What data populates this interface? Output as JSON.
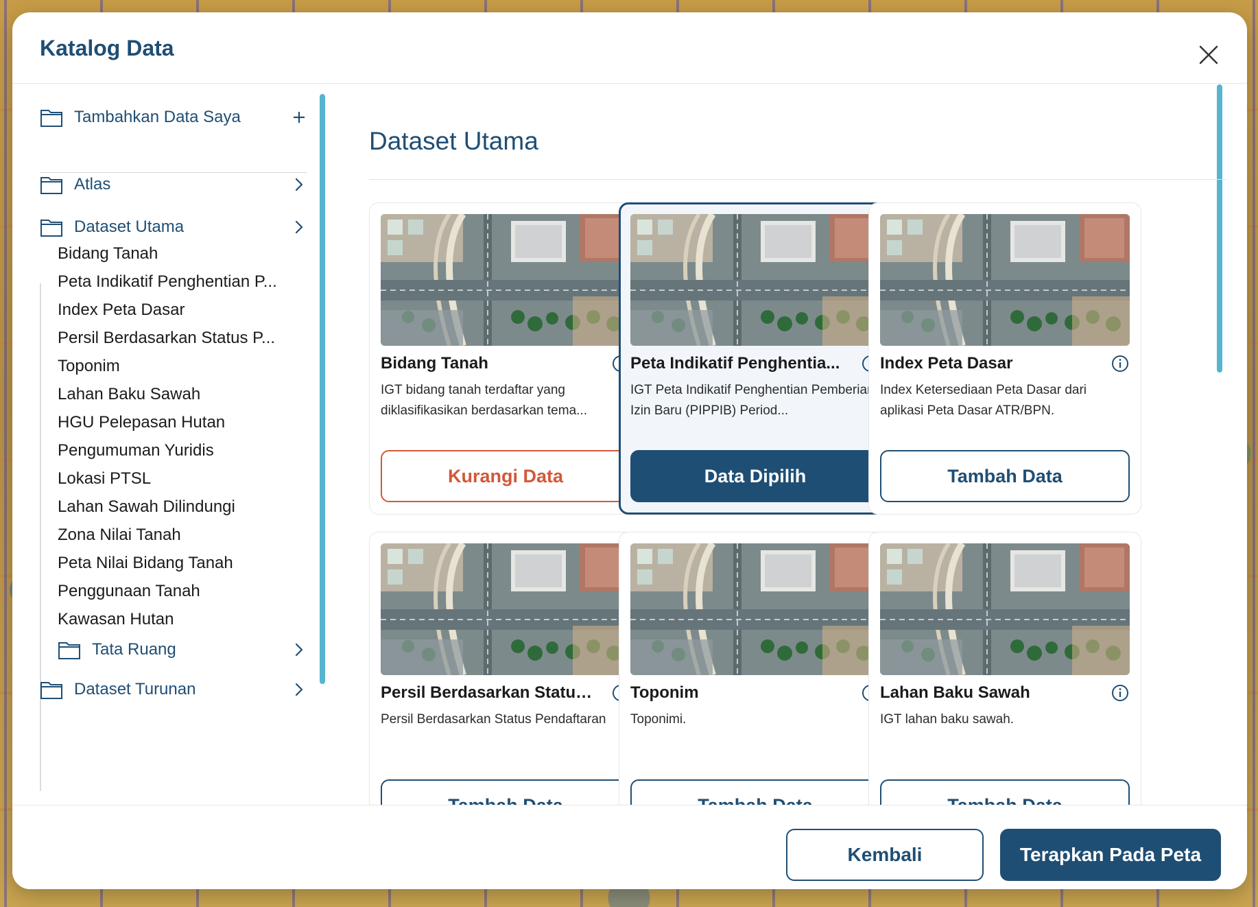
{
  "dialog": {
    "title": "Katalog Data",
    "close_icon": "close-icon"
  },
  "sidebar": {
    "add_item": {
      "label": "Tambahkan Data Saya",
      "icon": "folder-icon",
      "trail_icon": "plus-icon"
    },
    "folders": [
      {
        "label": "Atlas",
        "icon": "folder-icon",
        "trail_icon": "chevron-right-icon"
      },
      {
        "label": "Dataset Utama",
        "icon": "folder-icon",
        "trail_icon": "chevron-right-icon"
      }
    ],
    "sub_items": [
      "Bidang Tanah",
      "Peta Indikatif Penghentian P...",
      "Index Peta Dasar",
      "Persil Berdasarkan Status P...",
      "Toponim",
      "Lahan Baku Sawah",
      "HGU Pelepasan Hutan",
      "Pengumuman Yuridis",
      "Lokasi PTSL",
      "Lahan Sawah Dilindungi",
      "Zona Nilai Tanah",
      "Peta Nilai Bidang Tanah",
      "Penggunaan Tanah",
      "Kawasan Hutan"
    ],
    "nested_folder": {
      "label": "Tata Ruang",
      "icon": "folder-icon",
      "trail_icon": "chevron-right-icon"
    },
    "cut_folder": {
      "label": "Dataset Turunan",
      "icon": "folder-icon",
      "trail_icon": "chevron-right-icon"
    }
  },
  "main": {
    "title": "Dataset Utama",
    "cards": [
      {
        "title": "Bidang Tanah",
        "desc": "IGT bidang tanah terdaftar yang diklasifikasikan berdasarkan tema...",
        "button": "Kurangi Data",
        "state": "remove"
      },
      {
        "title": "Peta Indikatif Penghentia...",
        "desc": "IGT Peta Indikatif Penghentian Pemberian Izin Baru (PIPPIB) Period...",
        "button": "Data Dipilih",
        "state": "chosen"
      },
      {
        "title": "Index Peta Dasar",
        "desc": "Index Ketersediaan Peta Dasar dari aplikasi Peta Dasar ATR/BPN.",
        "button": "Tambah Data",
        "state": "add"
      },
      {
        "title": "Persil Berdasarkan Status ...",
        "desc": "Persil Berdasarkan Status Pendaftaran",
        "button": "Tambah Data",
        "state": "add"
      },
      {
        "title": "Toponim",
        "desc": "Toponimi.",
        "button": "Tambah Data",
        "state": "add"
      },
      {
        "title": "Lahan Baku Sawah",
        "desc": "IGT lahan baku sawah.",
        "button": "Tambah Data",
        "state": "add"
      }
    ]
  },
  "footer": {
    "back_label": "Kembali",
    "apply_label": "Terapkan Pada Peta"
  },
  "colors": {
    "primary": "#1f4e74",
    "danger": "#d2583a",
    "accent_scroll": "#56b4cf"
  }
}
